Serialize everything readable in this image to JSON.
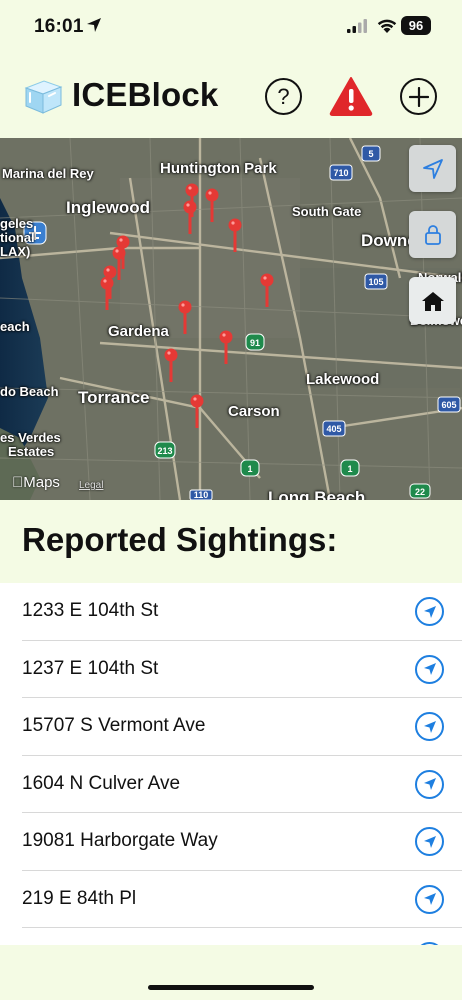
{
  "status_bar": {
    "time": "16:01",
    "battery": "96"
  },
  "header": {
    "app_name": "ICEBlock",
    "help_label": "?",
    "icons": [
      "ice-cube-logo",
      "help-icon",
      "warning-icon",
      "plus-icon"
    ]
  },
  "map": {
    "labels": [
      "Huntington Park",
      "Marina del Rey",
      "Inglewood",
      "South Gate",
      "geles",
      "tional",
      "LAX)",
      "Downey",
      "Norwalk",
      "each",
      "Gardena",
      "Bellflower",
      "do Beach",
      "Torrance",
      "Lakewood",
      "Carson",
      "es Verdes",
      "Estates",
      "Long Beach"
    ],
    "route_shields": [
      "5",
      "710",
      "105",
      "91",
      "605",
      "405",
      "213",
      "1",
      "1",
      "110",
      "22"
    ],
    "attribution": "Maps",
    "legal": "Legal",
    "pin_color": "#e53935",
    "controls": [
      "location-arrow-icon",
      "lock-icon",
      "home-icon"
    ]
  },
  "sightings": {
    "title": "Reported Sightings:",
    "items": [
      "1233 E 104th St",
      "1237 E 104th St",
      "15707 S Vermont Ave",
      "1604 N Culver Ave",
      "19081 Harborgate Way",
      "219 E 84th Pl"
    ],
    "accent": "#1e7fe0"
  }
}
